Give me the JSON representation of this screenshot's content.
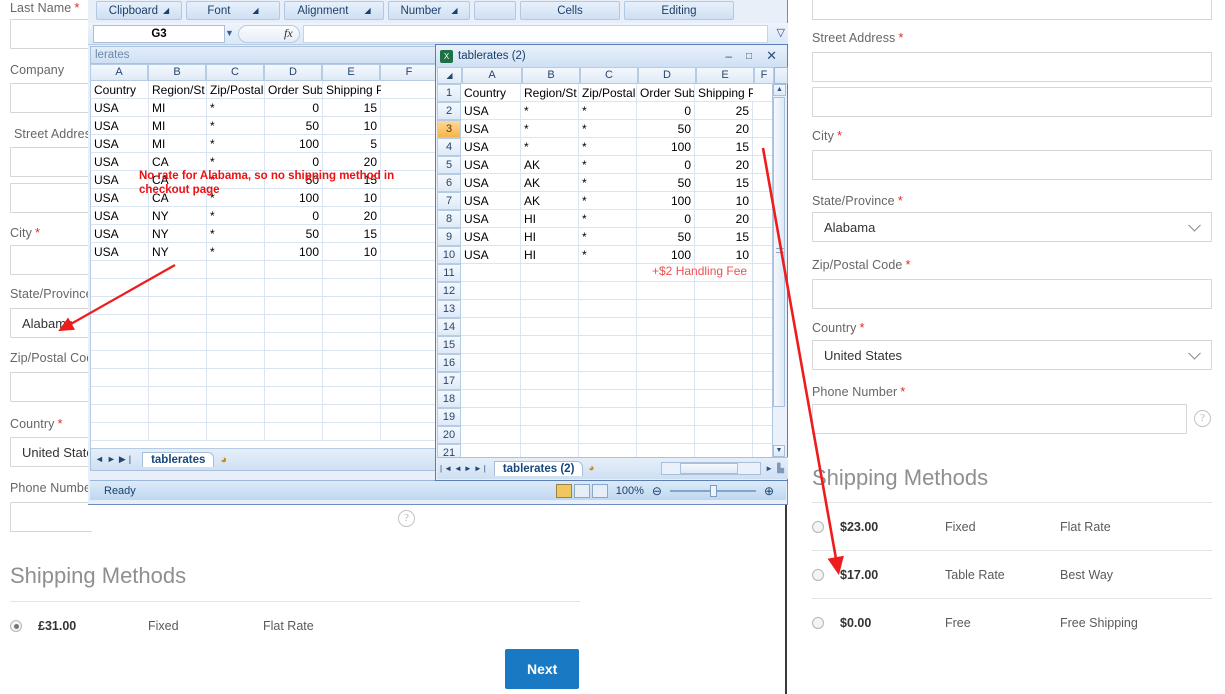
{
  "left_checkout": {
    "fields": [
      {
        "label": "Last Name",
        "required": true,
        "type": "text",
        "value": ""
      },
      {
        "label": "Company",
        "required": false,
        "type": "text",
        "value": ""
      },
      {
        "label": "Street Address",
        "required": true,
        "type": "text",
        "value": ""
      },
      {
        "label": "",
        "required": false,
        "type": "text",
        "value": ""
      },
      {
        "label": "City",
        "required": true,
        "type": "text",
        "value": ""
      },
      {
        "label": "State/Province",
        "required": true,
        "type": "select",
        "value": "Alabama"
      },
      {
        "label": "Zip/Postal Code",
        "required": true,
        "type": "text",
        "value": ""
      },
      {
        "label": "Country",
        "required": true,
        "type": "select",
        "value": "United States"
      },
      {
        "label": "Phone Number",
        "required": true,
        "type": "text",
        "value": ""
      }
    ],
    "shipping_title": "Shipping Methods",
    "shipping_methods": [
      {
        "price": "£31.00",
        "carrier": "Fixed",
        "method": "Flat Rate",
        "selected": true
      }
    ],
    "next_button": "Next",
    "help_icon": "question-mark-icon"
  },
  "right_checkout": {
    "fields": [
      {
        "label": "",
        "required": false,
        "type": "text",
        "value": ""
      },
      {
        "label": "Street Address",
        "required": true,
        "type": "text",
        "value": ""
      },
      {
        "label": "",
        "required": false,
        "type": "text",
        "value": ""
      },
      {
        "label": "City",
        "required": true,
        "type": "text",
        "value": ""
      },
      {
        "label": "State/Province",
        "required": true,
        "type": "select",
        "value": "Alabama"
      },
      {
        "label": "Zip/Postal Code",
        "required": true,
        "type": "text",
        "value": ""
      },
      {
        "label": "Country",
        "required": true,
        "type": "select",
        "value": "United States"
      },
      {
        "label": "Phone Number",
        "required": true,
        "type": "text",
        "value": ""
      }
    ],
    "shipping_title": "Shipping Methods",
    "shipping_methods": [
      {
        "price": "$23.00",
        "carrier": "Fixed",
        "method": "Flat Rate",
        "selected": false
      },
      {
        "price": "$17.00",
        "carrier": "Table Rate",
        "method": "Best Way",
        "selected": false
      },
      {
        "price": "$0.00",
        "carrier": "Free",
        "method": "Free Shipping",
        "selected": false
      }
    ],
    "help_icon": "question-mark-icon"
  },
  "excel_window_1": {
    "title_partial": "lerates",
    "ribbon_groups": [
      "Clipboard",
      "Font",
      "Alignment",
      "Number",
      "",
      "Cells",
      "Editing"
    ],
    "name_box": "G3",
    "formula_bar_value": "",
    "fx_label": "fx",
    "columns": [
      "A",
      "B",
      "C",
      "D",
      "E",
      "F"
    ],
    "header_row": [
      "Country",
      "Region/St",
      "Zip/Postal",
      "Order Sub",
      "Shipping Price"
    ],
    "rows": [
      [
        "USA",
        "MI",
        "*",
        "0",
        "15"
      ],
      [
        "USA",
        "MI",
        "*",
        "50",
        "10"
      ],
      [
        "USA",
        "MI",
        "*",
        "100",
        "5"
      ],
      [
        "USA",
        "CA",
        "*",
        "0",
        "20"
      ],
      [
        "USA",
        "CA",
        "*",
        "50",
        "15"
      ],
      [
        "USA",
        "CA",
        "*",
        "100",
        "10"
      ],
      [
        "USA",
        "NY",
        "*",
        "0",
        "20"
      ],
      [
        "USA",
        "NY",
        "*",
        "50",
        "15"
      ],
      [
        "USA",
        "NY",
        "*",
        "100",
        "10"
      ]
    ],
    "annotation": "No rate for Alabama, so no shipping method in checkout page",
    "sheet_tab": "tablerates",
    "status_text": "Ready",
    "zoom_level": "100%"
  },
  "excel_window_2": {
    "title": "tablerates (2)",
    "columns": [
      "A",
      "B",
      "C",
      "D",
      "E",
      "F"
    ],
    "row_numbers": [
      "1",
      "2",
      "3",
      "4",
      "5",
      "6",
      "7",
      "8",
      "9",
      "10",
      "11",
      "12",
      "13",
      "14",
      "15",
      "16",
      "17",
      "18",
      "19",
      "20",
      "21"
    ],
    "header_row": [
      "Country",
      "Region/St",
      "Zip/Postal",
      "Order Sub",
      "Shipping Price"
    ],
    "rows": [
      [
        "USA",
        "*",
        "*",
        "0",
        "25"
      ],
      [
        "USA",
        "*",
        "*",
        "50",
        "20"
      ],
      [
        "USA",
        "*",
        "*",
        "100",
        "15"
      ],
      [
        "USA",
        "AK",
        "*",
        "0",
        "20"
      ],
      [
        "USA",
        "AK",
        "*",
        "50",
        "15"
      ],
      [
        "USA",
        "AK",
        "*",
        "100",
        "10"
      ],
      [
        "USA",
        "HI",
        "*",
        "0",
        "20"
      ],
      [
        "USA",
        "HI",
        "*",
        "50",
        "15"
      ],
      [
        "USA",
        "HI",
        "*",
        "100",
        "10"
      ]
    ],
    "selected_row": "3",
    "annotation": "+$2 Handling Fee",
    "sheet_tab": "tablerates (2)",
    "minimize_icon": "minimize-icon",
    "maximize_icon": "maximize-icon",
    "close_icon": "close-icon"
  },
  "colors": {
    "annotation_red": "#ee1111",
    "annotation_light_red": "#f05050",
    "arrow_red": "#ee1c1c",
    "button_blue": "#1979c3",
    "required_star": "#e02b27"
  }
}
